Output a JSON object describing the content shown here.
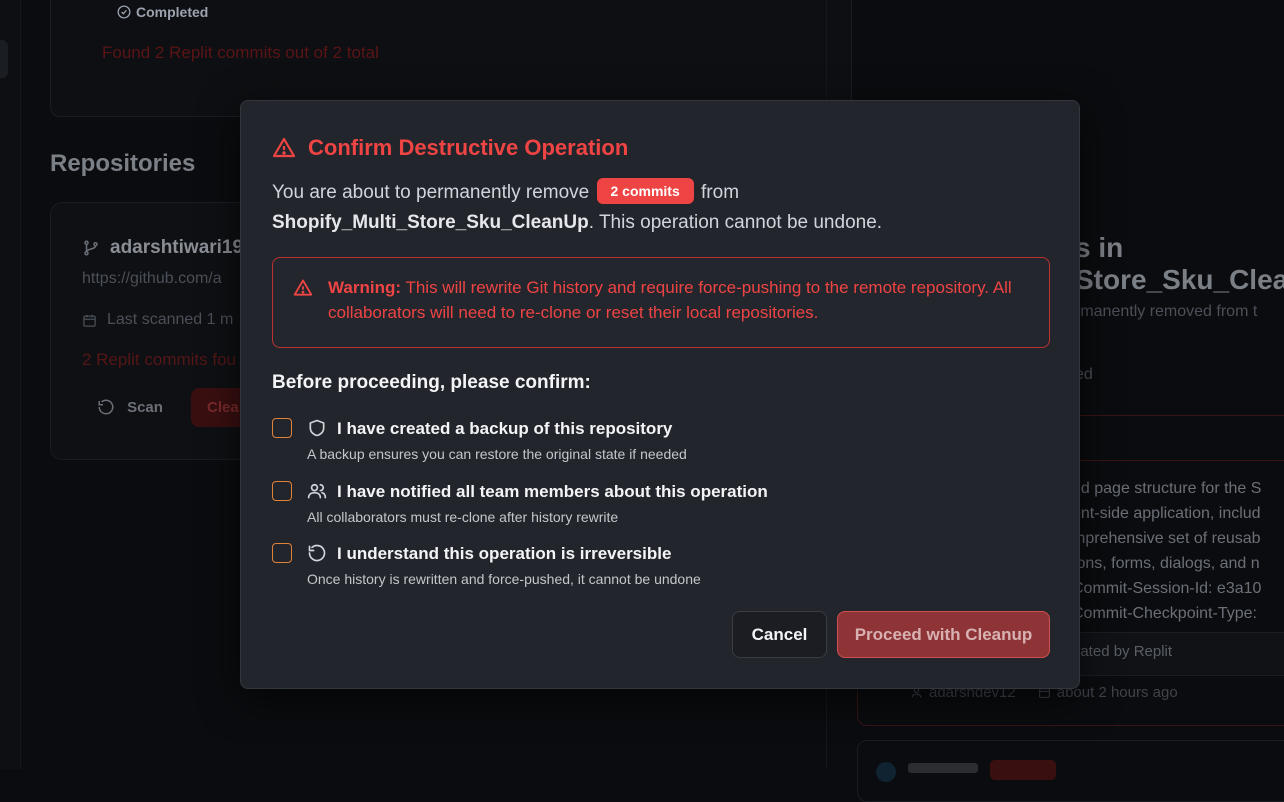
{
  "background": {
    "status": "Completed",
    "found_text": "Found 2 Replit commits out of 2 total",
    "repos_heading": "Repositories",
    "repo": {
      "name": "adarshtiwari19",
      "url": "https://github.com/a",
      "last_scanned": "Last scanned 1 m",
      "commits_found": "2 Replit commits fou",
      "scan_label": "Scan",
      "cleanup_label": "Clea"
    },
    "right_panel": {
      "title_line1": "s in",
      "title_line2": "Store_Sku_Clean",
      "subtitle": "rmanently removed from t",
      "ed_text": "ed",
      "commit_body": "nd page structure for the S\nent-side application, includ\nmprehensive set of reusab\ntons, forms, dialogs, and n\nCommit-Session-Id: e3a10\nCommit-Checkpoint-Type:",
      "generated_by": "erated by Replit",
      "author": "adarshdev12",
      "time": "about 2 hours ago"
    }
  },
  "modal": {
    "title": "Confirm Destructive Operation",
    "desc_before": "You are about to permanently remove ",
    "badge": "2 commits",
    "desc_after": " from",
    "repo_name": "Shopify_Multi_Store_Sku_CleanUp",
    "desc_end": ". This operation cannot be undone.",
    "warning_label": "Warning:",
    "warning_text": " This will rewrite Git history and require force-pushing to the remote repository. All collaborators will need to re-clone or reset their local repositories.",
    "confirm_heading": "Before proceeding, please confirm:",
    "items": [
      {
        "icon": "shield-icon",
        "label": "I have created a backup of this repository",
        "sub": "A backup ensures you can restore the original state if needed"
      },
      {
        "icon": "users-icon",
        "label": "I have notified all team members about this operation",
        "sub": "All collaborators must re-clone after history rewrite"
      },
      {
        "icon": "rotate-icon",
        "label": "I understand this operation is irreversible",
        "sub": "Once history is rewritten and force-pushed, it cannot be undone"
      }
    ],
    "cancel_label": "Cancel",
    "proceed_label": "Proceed with Cleanup"
  },
  "colors": {
    "danger": "#ef4444",
    "checkbox_border": "#e0823a",
    "modal_bg": "#22252b",
    "page_bg": "#0b0c0f",
    "proceed_disabled": "#8e3436"
  }
}
